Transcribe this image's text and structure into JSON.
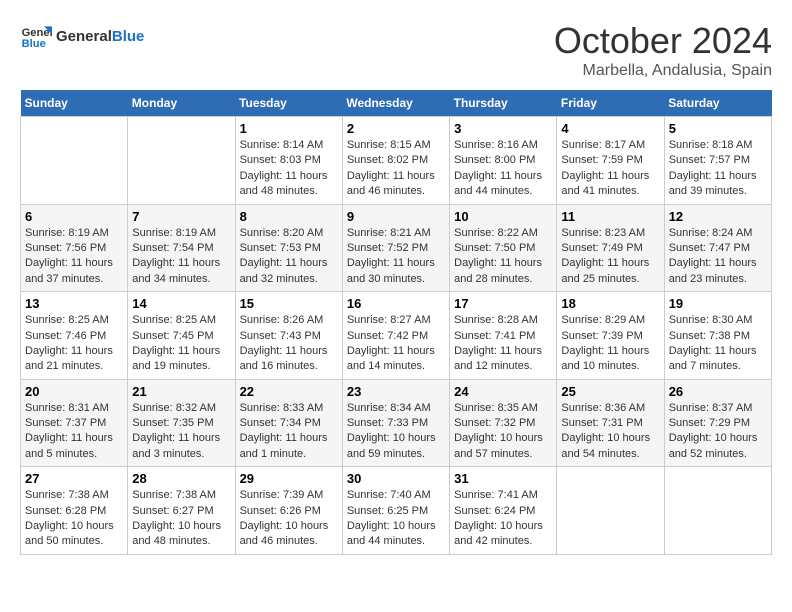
{
  "header": {
    "logo_text_general": "General",
    "logo_text_blue": "Blue",
    "month_title": "October 2024",
    "location": "Marbella, Andalusia, Spain"
  },
  "days_of_week": [
    "Sunday",
    "Monday",
    "Tuesday",
    "Wednesday",
    "Thursday",
    "Friday",
    "Saturday"
  ],
  "weeks": [
    [
      {
        "day": "",
        "sunrise": "",
        "sunset": "",
        "daylight": ""
      },
      {
        "day": "",
        "sunrise": "",
        "sunset": "",
        "daylight": ""
      },
      {
        "day": "1",
        "sunrise": "Sunrise: 8:14 AM",
        "sunset": "Sunset: 8:03 PM",
        "daylight": "Daylight: 11 hours and 48 minutes."
      },
      {
        "day": "2",
        "sunrise": "Sunrise: 8:15 AM",
        "sunset": "Sunset: 8:02 PM",
        "daylight": "Daylight: 11 hours and 46 minutes."
      },
      {
        "day": "3",
        "sunrise": "Sunrise: 8:16 AM",
        "sunset": "Sunset: 8:00 PM",
        "daylight": "Daylight: 11 hours and 44 minutes."
      },
      {
        "day": "4",
        "sunrise": "Sunrise: 8:17 AM",
        "sunset": "Sunset: 7:59 PM",
        "daylight": "Daylight: 11 hours and 41 minutes."
      },
      {
        "day": "5",
        "sunrise": "Sunrise: 8:18 AM",
        "sunset": "Sunset: 7:57 PM",
        "daylight": "Daylight: 11 hours and 39 minutes."
      }
    ],
    [
      {
        "day": "6",
        "sunrise": "Sunrise: 8:19 AM",
        "sunset": "Sunset: 7:56 PM",
        "daylight": "Daylight: 11 hours and 37 minutes."
      },
      {
        "day": "7",
        "sunrise": "Sunrise: 8:19 AM",
        "sunset": "Sunset: 7:54 PM",
        "daylight": "Daylight: 11 hours and 34 minutes."
      },
      {
        "day": "8",
        "sunrise": "Sunrise: 8:20 AM",
        "sunset": "Sunset: 7:53 PM",
        "daylight": "Daylight: 11 hours and 32 minutes."
      },
      {
        "day": "9",
        "sunrise": "Sunrise: 8:21 AM",
        "sunset": "Sunset: 7:52 PM",
        "daylight": "Daylight: 11 hours and 30 minutes."
      },
      {
        "day": "10",
        "sunrise": "Sunrise: 8:22 AM",
        "sunset": "Sunset: 7:50 PM",
        "daylight": "Daylight: 11 hours and 28 minutes."
      },
      {
        "day": "11",
        "sunrise": "Sunrise: 8:23 AM",
        "sunset": "Sunset: 7:49 PM",
        "daylight": "Daylight: 11 hours and 25 minutes."
      },
      {
        "day": "12",
        "sunrise": "Sunrise: 8:24 AM",
        "sunset": "Sunset: 7:47 PM",
        "daylight": "Daylight: 11 hours and 23 minutes."
      }
    ],
    [
      {
        "day": "13",
        "sunrise": "Sunrise: 8:25 AM",
        "sunset": "Sunset: 7:46 PM",
        "daylight": "Daylight: 11 hours and 21 minutes."
      },
      {
        "day": "14",
        "sunrise": "Sunrise: 8:25 AM",
        "sunset": "Sunset: 7:45 PM",
        "daylight": "Daylight: 11 hours and 19 minutes."
      },
      {
        "day": "15",
        "sunrise": "Sunrise: 8:26 AM",
        "sunset": "Sunset: 7:43 PM",
        "daylight": "Daylight: 11 hours and 16 minutes."
      },
      {
        "day": "16",
        "sunrise": "Sunrise: 8:27 AM",
        "sunset": "Sunset: 7:42 PM",
        "daylight": "Daylight: 11 hours and 14 minutes."
      },
      {
        "day": "17",
        "sunrise": "Sunrise: 8:28 AM",
        "sunset": "Sunset: 7:41 PM",
        "daylight": "Daylight: 11 hours and 12 minutes."
      },
      {
        "day": "18",
        "sunrise": "Sunrise: 8:29 AM",
        "sunset": "Sunset: 7:39 PM",
        "daylight": "Daylight: 11 hours and 10 minutes."
      },
      {
        "day": "19",
        "sunrise": "Sunrise: 8:30 AM",
        "sunset": "Sunset: 7:38 PM",
        "daylight": "Daylight: 11 hours and 7 minutes."
      }
    ],
    [
      {
        "day": "20",
        "sunrise": "Sunrise: 8:31 AM",
        "sunset": "Sunset: 7:37 PM",
        "daylight": "Daylight: 11 hours and 5 minutes."
      },
      {
        "day": "21",
        "sunrise": "Sunrise: 8:32 AM",
        "sunset": "Sunset: 7:35 PM",
        "daylight": "Daylight: 11 hours and 3 minutes."
      },
      {
        "day": "22",
        "sunrise": "Sunrise: 8:33 AM",
        "sunset": "Sunset: 7:34 PM",
        "daylight": "Daylight: 11 hours and 1 minute."
      },
      {
        "day": "23",
        "sunrise": "Sunrise: 8:34 AM",
        "sunset": "Sunset: 7:33 PM",
        "daylight": "Daylight: 10 hours and 59 minutes."
      },
      {
        "day": "24",
        "sunrise": "Sunrise: 8:35 AM",
        "sunset": "Sunset: 7:32 PM",
        "daylight": "Daylight: 10 hours and 57 minutes."
      },
      {
        "day": "25",
        "sunrise": "Sunrise: 8:36 AM",
        "sunset": "Sunset: 7:31 PM",
        "daylight": "Daylight: 10 hours and 54 minutes."
      },
      {
        "day": "26",
        "sunrise": "Sunrise: 8:37 AM",
        "sunset": "Sunset: 7:29 PM",
        "daylight": "Daylight: 10 hours and 52 minutes."
      }
    ],
    [
      {
        "day": "27",
        "sunrise": "Sunrise: 7:38 AM",
        "sunset": "Sunset: 6:28 PM",
        "daylight": "Daylight: 10 hours and 50 minutes."
      },
      {
        "day": "28",
        "sunrise": "Sunrise: 7:38 AM",
        "sunset": "Sunset: 6:27 PM",
        "daylight": "Daylight: 10 hours and 48 minutes."
      },
      {
        "day": "29",
        "sunrise": "Sunrise: 7:39 AM",
        "sunset": "Sunset: 6:26 PM",
        "daylight": "Daylight: 10 hours and 46 minutes."
      },
      {
        "day": "30",
        "sunrise": "Sunrise: 7:40 AM",
        "sunset": "Sunset: 6:25 PM",
        "daylight": "Daylight: 10 hours and 44 minutes."
      },
      {
        "day": "31",
        "sunrise": "Sunrise: 7:41 AM",
        "sunset": "Sunset: 6:24 PM",
        "daylight": "Daylight: 10 hours and 42 minutes."
      },
      {
        "day": "",
        "sunrise": "",
        "sunset": "",
        "daylight": ""
      },
      {
        "day": "",
        "sunrise": "",
        "sunset": "",
        "daylight": ""
      }
    ]
  ]
}
